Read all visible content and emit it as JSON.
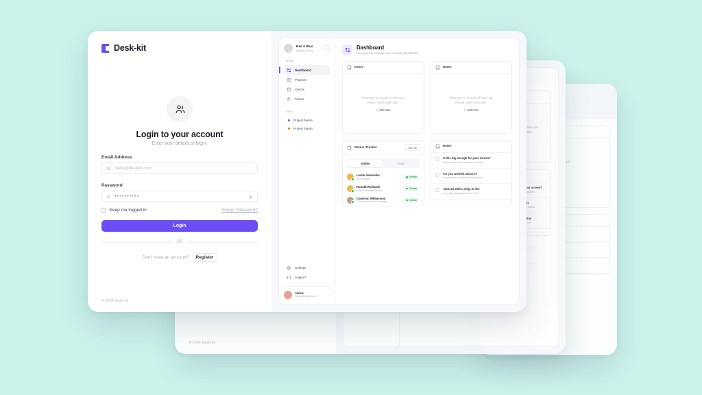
{
  "background_color": "#ccf2ec",
  "accent_color": "#6d4df6",
  "online_color": "#22c55e",
  "brand": {
    "name": "Desk-kit",
    "mark": "desk-kit-logo"
  },
  "login": {
    "title": "Login to your account",
    "subtitle": "Enter your details to login.",
    "avatar_icon": "users-icon",
    "email": {
      "label": "Email Address",
      "placeholder": "hello@deskkit.com",
      "value": "",
      "icon": "mail-icon"
    },
    "password": {
      "label": "Password",
      "value": "••••••••••",
      "icon": "lock-icon",
      "toggle_icon": "eye-icon"
    },
    "keep_logged_in": "Keep me logged in",
    "forgot_password": "Forget Password?",
    "submit": "Login",
    "divider": "OR",
    "register_question": "Don't have an account?",
    "register": "Register",
    "copyright": "© 2024 Desk-kit"
  },
  "dashboard": {
    "sidebar": {
      "org": {
        "name": "Red & Blue",
        "subtitle": "Design Studio",
        "avatar": "org-avatar",
        "switch_icon": "chevron-updown-icon"
      },
      "sections": [
        {
          "label": "MAIN",
          "items": [
            {
              "label": "Dashboard",
              "icon": "grid-icon",
              "active": true,
              "chevron": "›"
            },
            {
              "label": "Projects",
              "icon": "folder-icon",
              "active": false
            },
            {
              "label": "Clients",
              "icon": "building-icon",
              "active": false
            },
            {
              "label": "Teams",
              "icon": "people-icon",
              "active": false
            }
          ]
        },
        {
          "label": "FAVS",
          "items": [
            {
              "label": "Project Name",
              "dot": "#6d4df6"
            },
            {
              "label": "Project Name",
              "dot": "#f97316"
            }
          ]
        }
      ],
      "bottom": [
        {
          "label": "Settings",
          "icon": "gear-icon"
        },
        {
          "label": "Support",
          "icon": "headset-icon"
        }
      ],
      "user": {
        "name": "Name",
        "email": "Name@email.com",
        "chevron": "›"
      }
    },
    "header": {
      "title": "Dashboard",
      "subtitle": "Here you can manage your company dashboard",
      "icon": "dashboard-grid-icon"
    },
    "notes_card": {
      "title": "Notes",
      "icon": "note-icon",
      "empty_line1": "There are no records of notes yet.",
      "empty_line2": "Please check back later.",
      "add_label": "Add Note",
      "add_icon": "plus-icon"
    },
    "status_tracker": {
      "title": "Status Tracker",
      "icon": "tracker-icon",
      "see_all": "See all",
      "tabs": [
        {
          "label": "Online",
          "active": true
        },
        {
          "label": "Away",
          "active": false
        }
      ],
      "people": [
        {
          "name": "Leslie Alexander",
          "role": "Ux Designer",
          "status": "Online",
          "avatar_color": "#f3b54a"
        },
        {
          "name": "Ronald Richards",
          "role": "Chief Executive Officer",
          "status": "Online",
          "avatar_color": "#edc04a"
        },
        {
          "name": "Cameron Williamson",
          "role": "Customer Service Manager",
          "status": "Online",
          "avatar_color": "#c3a08c"
        }
      ]
    },
    "notes_list": {
      "title": "Notes",
      "icon": "note-icon",
      "items": [
        {
          "title": "Is this big enough for your screen?",
          "desc": "When faced with a complex problem"
        },
        {
          "title": "Are you worried about it?",
          "desc": "Geometry is a way of thinking about"
        },
        {
          "title": "I danced with a ninja in line",
          "desc": "How many triangles do we need"
        }
      ]
    }
  }
}
